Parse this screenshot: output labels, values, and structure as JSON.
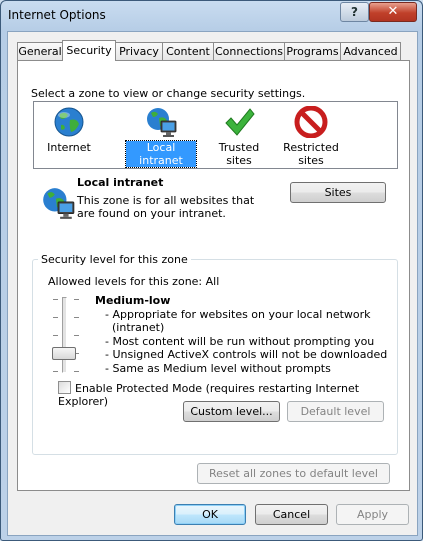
{
  "window": {
    "title": "Internet Options",
    "help_label": "?",
    "close_label": "✕"
  },
  "tabs": [
    {
      "label": "General"
    },
    {
      "label": "Security",
      "active": true
    },
    {
      "label": "Privacy"
    },
    {
      "label": "Content"
    },
    {
      "label": "Connections"
    },
    {
      "label": "Programs"
    },
    {
      "label": "Advanced"
    }
  ],
  "zones": {
    "prompt": "Select a zone to view or change security settings.",
    "items": [
      {
        "label": "Internet",
        "icon": "globe-icon"
      },
      {
        "label": "Local intranet",
        "icon": "local-intranet-icon",
        "selected": true
      },
      {
        "label": "Trusted sites",
        "icon": "checkmark-icon"
      },
      {
        "label": "Restricted sites",
        "icon": "restricted-icon"
      }
    ]
  },
  "zone_detail": {
    "name": "Local intranet",
    "description": "This zone is for all websites that are found on your intranet.",
    "sites_button": "Sites"
  },
  "security_level": {
    "group_title": "Security level for this zone",
    "allowed": "Allowed levels for this zone: All",
    "slider_level": 1,
    "slider_max": 4,
    "level_name": "Medium-low",
    "level_items": [
      "- Appropriate for websites on your local network",
      "(intranet)",
      "- Most content will be run without prompting you",
      "- Unsigned ActiveX controls will not be downloaded",
      "- Same as Medium level without prompts"
    ],
    "protected_mode_label": "Enable Protected Mode (requires restarting Internet Explorer)",
    "protected_mode_checked": false,
    "custom_level_button": "Custom level...",
    "default_level_button": "Default level"
  },
  "reset_all_button": "Reset all zones to default level",
  "footer": {
    "ok": "OK",
    "cancel": "Cancel",
    "apply": "Apply"
  }
}
